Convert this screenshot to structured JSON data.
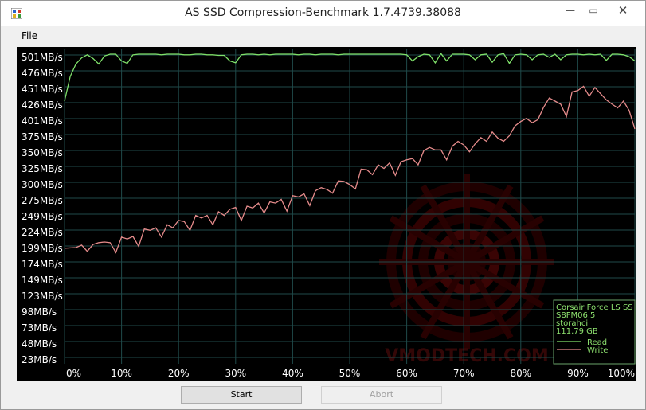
{
  "window": {
    "title": "AS SSD Compression-Benchmark 1.7.4739.38088",
    "minimize_glyph": "—",
    "maximize_glyph": "▭",
    "close_glyph": "✕"
  },
  "menu": {
    "file": "File"
  },
  "buttons": {
    "start": "Start",
    "abort": "Abort"
  },
  "colors": {
    "read": "#7fe06a",
    "write": "#e58b8b",
    "grid": "#1f4a4a",
    "label": "#ffffff",
    "legend_text": "#8ee26f"
  },
  "chart_data": {
    "type": "line",
    "x_ticks": [
      "0%",
      "10%",
      "20%",
      "30%",
      "40%",
      "50%",
      "60%",
      "70%",
      "80%",
      "90%",
      "100%"
    ],
    "y_ticks": [
      "501MB/s",
      "476MB/s",
      "451MB/s",
      "426MB/s",
      "401MB/s",
      "375MB/s",
      "350MB/s",
      "325MB/s",
      "300MB/s",
      "275MB/s",
      "249MB/s",
      "224MB/s",
      "199MB/s",
      "174MB/s",
      "149MB/s",
      "123MB/s",
      "98MB/s",
      "73MB/s",
      "48MB/s",
      "23MB/s"
    ],
    "ylim": [
      0,
      510
    ],
    "xlim": [
      0,
      100
    ],
    "series": [
      {
        "name": "Read",
        "x": [
          0,
          1,
          2,
          3,
          4,
          5,
          6,
          7,
          8,
          9,
          10,
          11,
          12,
          13,
          14,
          15,
          16,
          17,
          18,
          19,
          20,
          21,
          22,
          23,
          24,
          25,
          26,
          27,
          28,
          29,
          30,
          31,
          32,
          33,
          34,
          35,
          36,
          37,
          38,
          39,
          40,
          41,
          42,
          43,
          44,
          45,
          46,
          47,
          48,
          49,
          50,
          51,
          52,
          53,
          54,
          55,
          56,
          57,
          58,
          59,
          60,
          61,
          62,
          63,
          64,
          65,
          66,
          67,
          68,
          69,
          70,
          71,
          72,
          73,
          74,
          75,
          76,
          77,
          78,
          79,
          80,
          81,
          82,
          83,
          84,
          85,
          86,
          87,
          88,
          89,
          90,
          91,
          92,
          93,
          94,
          95,
          96,
          97,
          98,
          99,
          100
        ],
        "values": [
          425,
          465,
          485,
          495,
          500,
          494,
          485,
          498,
          501,
          501,
          490,
          486,
          500,
          501,
          501,
          501,
          501,
          500,
          501,
          501,
          501,
          500,
          500,
          501,
          501,
          500,
          500,
          499,
          499,
          490,
          487,
          500,
          501,
          501,
          500,
          501,
          500,
          501,
          501,
          501,
          501,
          500,
          501,
          501,
          500,
          501,
          501,
          501,
          500,
          501,
          501,
          501,
          501,
          501,
          501,
          501,
          501,
          501,
          501,
          501,
          500,
          490,
          497,
          501,
          500,
          487,
          502,
          490,
          501,
          501,
          501,
          500,
          492,
          500,
          501,
          488,
          500,
          502,
          486,
          500,
          501,
          500,
          492,
          500,
          501,
          496,
          501,
          492,
          500,
          501,
          501,
          500,
          501,
          500,
          501,
          491,
          501,
          501,
          500,
          497,
          490
        ]
      },
      {
        "name": "Write",
        "x": [
          0,
          2,
          3,
          4,
          5,
          6,
          7,
          8,
          9,
          10,
          11,
          12,
          13,
          14,
          15,
          16,
          17,
          18,
          19,
          20,
          21,
          22,
          23,
          24,
          25,
          26,
          27,
          28,
          29,
          30,
          31,
          32,
          33,
          34,
          35,
          36,
          37,
          38,
          39,
          40,
          41,
          42,
          43,
          44,
          45,
          46,
          47,
          48,
          49,
          50,
          51,
          52,
          53,
          54,
          55,
          56,
          57,
          58,
          59,
          60,
          61,
          62,
          63,
          64,
          65,
          66,
          67,
          68,
          69,
          70,
          71,
          72,
          73,
          74,
          75,
          76,
          77,
          78,
          79,
          80,
          81,
          82,
          83,
          84,
          85,
          86,
          87,
          88,
          89,
          90,
          91,
          92,
          93,
          94,
          95,
          96,
          97,
          98,
          99,
          100
        ],
        "values": [
          187,
          188,
          192,
          182,
          193,
          196,
          197,
          196,
          180,
          205,
          202,
          206,
          190,
          218,
          216,
          220,
          205,
          225,
          220,
          232,
          230,
          216,
          240,
          236,
          240,
          225,
          246,
          240,
          250,
          253,
          232,
          255,
          252,
          260,
          244,
          262,
          260,
          266,
          247,
          272,
          270,
          275,
          256,
          280,
          285,
          282,
          276,
          296,
          295,
          290,
          283,
          315,
          314,
          306,
          322,
          316,
          325,
          305,
          327,
          330,
          332,
          322,
          345,
          350,
          346,
          346,
          330,
          352,
          360,
          354,
          343,
          356,
          366,
          360,
          375,
          365,
          360,
          369,
          385,
          392,
          397,
          390,
          395,
          415,
          430,
          425,
          420,
          400,
          440,
          442,
          449,
          433,
          447,
          437,
          427,
          420,
          414,
          425,
          410,
          380
        ]
      }
    ],
    "legend": {
      "device": "Corsair Force LS SS",
      "firmware": "S8FM06.5",
      "driver": "storahci",
      "size": "111.79 GB",
      "read_label": "Read",
      "write_label": "Write"
    },
    "grid": true,
    "watermark": "VMODTECH.COM"
  }
}
